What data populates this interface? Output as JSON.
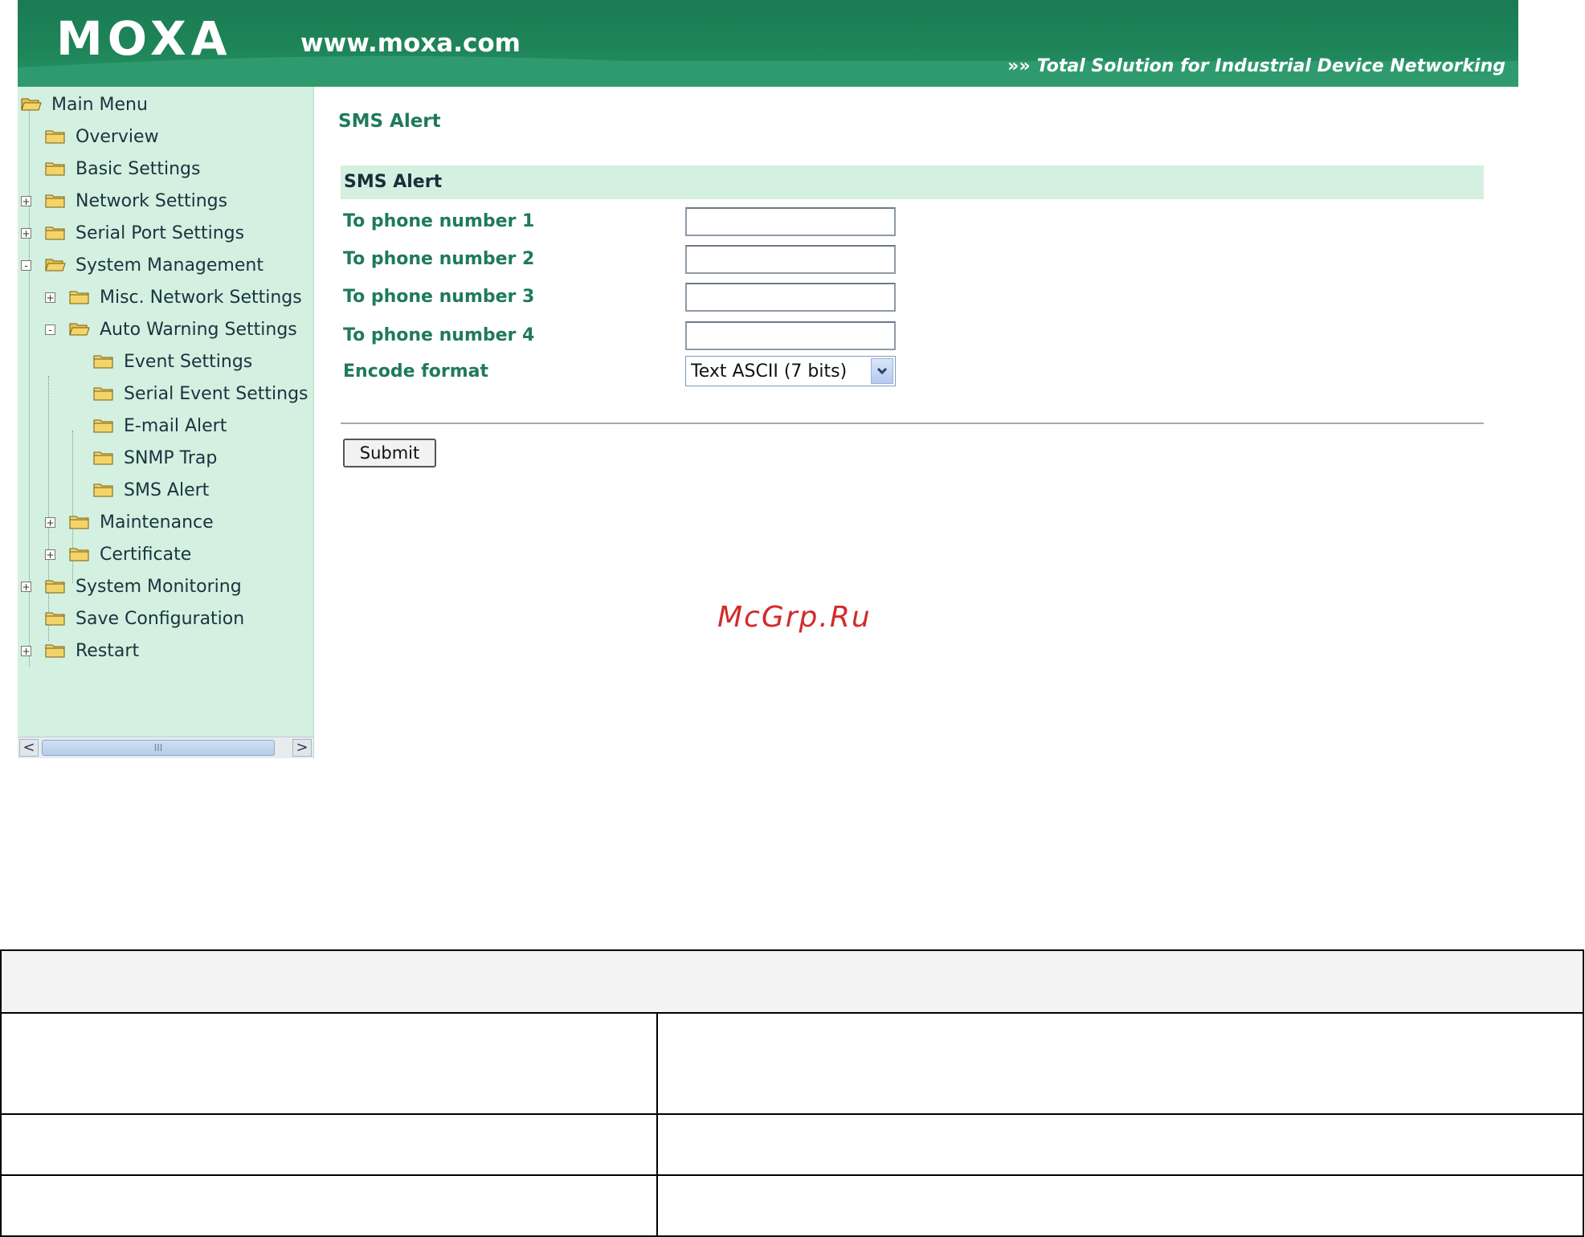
{
  "header": {
    "logo": "MOXA",
    "site_url": "www.moxa.com",
    "tagline_icon": "double-chevron-right-icon",
    "tagline": "Total Solution for Industrial Device Networking"
  },
  "sidebar": {
    "items": [
      {
        "label": "Main Menu",
        "state": "open"
      },
      {
        "label": "Overview"
      },
      {
        "label": "Basic Settings"
      },
      {
        "label": "Network Settings",
        "expander": "+"
      },
      {
        "label": "Serial Port Settings",
        "expander": "+"
      },
      {
        "label": "System Management",
        "expander": "-",
        "state": "open"
      },
      {
        "label": "Misc. Network Settings",
        "expander": "+"
      },
      {
        "label": "Auto Warning Settings",
        "expander": "-",
        "state": "open"
      },
      {
        "label": "Event Settings"
      },
      {
        "label": "Serial Event Settings"
      },
      {
        "label": "E-mail Alert"
      },
      {
        "label": "SNMP Trap"
      },
      {
        "label": "SMS Alert"
      },
      {
        "label": "Maintenance",
        "expander": "+"
      },
      {
        "label": "Certificate",
        "expander": "+"
      },
      {
        "label": "System Monitoring",
        "expander": "+"
      },
      {
        "label": "Save Configuration"
      },
      {
        "label": "Restart",
        "expander": "+"
      }
    ],
    "scrollbar": {
      "left_arrow": "<",
      "right_arrow": ">",
      "thumb_grip": "III"
    }
  },
  "main": {
    "page_title": "SMS Alert",
    "section_title": "SMS Alert",
    "fields": [
      {
        "label": "To phone number 1",
        "value": ""
      },
      {
        "label": "To phone number 2",
        "value": ""
      },
      {
        "label": "To phone number 3",
        "value": ""
      },
      {
        "label": "To phone number 4",
        "value": ""
      }
    ],
    "encode_format": {
      "label": "Encode format",
      "selected": "Text ASCII (7 bits)"
    },
    "submit_label": "Submit"
  },
  "watermark": "McGrp.Ru",
  "colors": {
    "header_green": "#1e8659",
    "sidebar_bg": "#d4f0e0",
    "label_green": "#1f7a5c",
    "watermark_red": "#d42a2a"
  }
}
